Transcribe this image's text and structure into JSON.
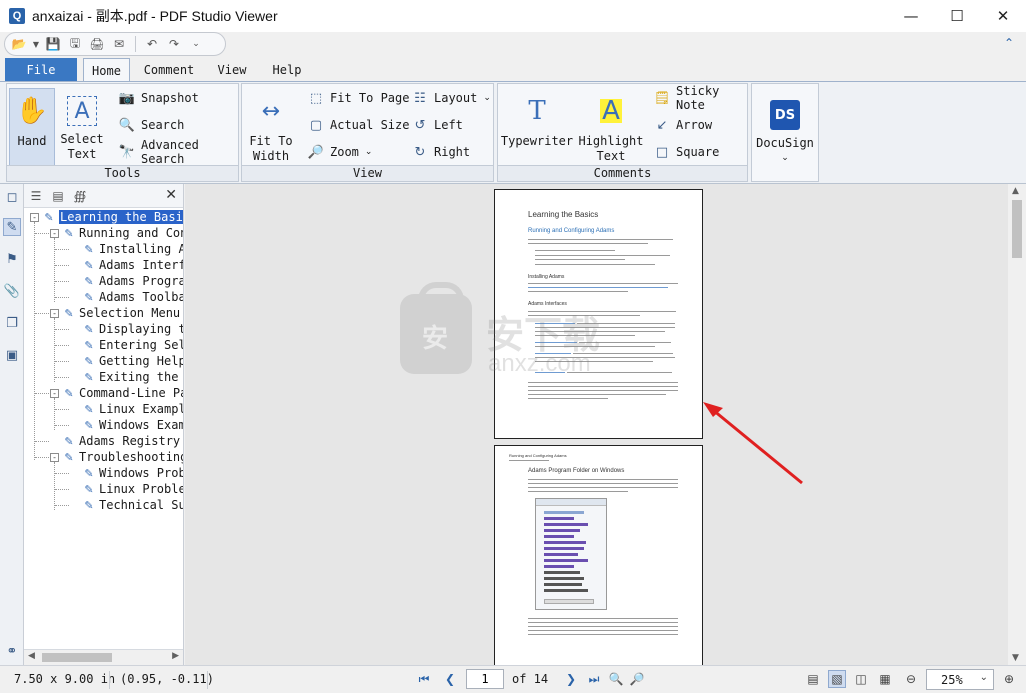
{
  "window": {
    "app_icon": "Q",
    "title": "anxaizai - 副本.pdf - PDF Studio Viewer",
    "controls": [
      "minimize-icon",
      "maximize-icon",
      "close-icon"
    ]
  },
  "qat": {
    "items": [
      "open-icon",
      "dropdown-icon",
      "save-icon",
      "save-as-icon",
      "print-icon",
      "email-icon",
      "undo-icon",
      "redo-icon",
      "customize-icon"
    ]
  },
  "tabs": [
    {
      "label": "File"
    },
    {
      "label": "Home"
    },
    {
      "label": "Comment"
    },
    {
      "label": "View"
    },
    {
      "label": "Help"
    }
  ],
  "ribbon": {
    "groups": {
      "tools": {
        "label": "Tools",
        "hand": "Hand",
        "select_text": "Select\nText",
        "snapshot": "Snapshot",
        "search": "Search",
        "advanced_search": "Advanced Search"
      },
      "view": {
        "label": "View",
        "fit_to_width": "Fit To\nWidth",
        "fit_to_page": "Fit To Page",
        "actual_size": "Actual Size",
        "zoom": "Zoom",
        "layout": "Layout",
        "left": "Left",
        "right": "Right"
      },
      "comments": {
        "label": "Comments",
        "typewriter": "Typewriter",
        "highlight_text": "Highlight\nText",
        "sticky_note": "Sticky Note",
        "arrow": "Arrow",
        "square": "Square"
      },
      "docusign": {
        "label": "DocuSign"
      }
    }
  },
  "bookmarks": [
    {
      "label": "Learning the Basics",
      "level": 0,
      "expanded": true,
      "selected": true
    },
    {
      "label": "Running and Confi",
      "level": 1,
      "expanded": true
    },
    {
      "label": "Installing Ada",
      "level": 2
    },
    {
      "label": "Adams Interfac",
      "level": 2
    },
    {
      "label": "Adams Program",
      "level": 2
    },
    {
      "label": "Adams Toolbar",
      "level": 2
    },
    {
      "label": "Selection Menu",
      "level": 1,
      "expanded": true
    },
    {
      "label": "Displaying the",
      "level": 2
    },
    {
      "label": "Entering Selec",
      "level": 2
    },
    {
      "label": "Getting Help",
      "level": 2
    },
    {
      "label": "Exiting the Se",
      "level": 2
    },
    {
      "label": "Command-Line Pars",
      "level": 1,
      "expanded": true
    },
    {
      "label": "Linux Example",
      "level": 2
    },
    {
      "label": "Windows Exampl",
      "level": 2
    },
    {
      "label": "Adams Registry Ed",
      "level": 1
    },
    {
      "label": "Troubleshooting",
      "level": 1,
      "expanded": true
    },
    {
      "label": "Windows Proble",
      "level": 2
    },
    {
      "label": "Linux Problem",
      "level": 2
    },
    {
      "label": "Technical Supp",
      "level": 2
    }
  ],
  "document": {
    "page1": {
      "title": "Learning the Basics",
      "heading": "Running and Configuring Adams",
      "sub1": "Installing Adams",
      "sub2": "Adams Interfaces"
    },
    "page2": {
      "header": "Running and Configuring Adams",
      "title": "Adams Program Folder on Windows"
    },
    "watermark": {
      "char": "安",
      "text": "安下载",
      "sub": "anxz.com"
    }
  },
  "status": {
    "page_size": "7.50 x 9.00 in",
    "coords": "(0.95, -0.11)",
    "current_page": "1",
    "page_of": "of 14",
    "zoom": "25%"
  }
}
